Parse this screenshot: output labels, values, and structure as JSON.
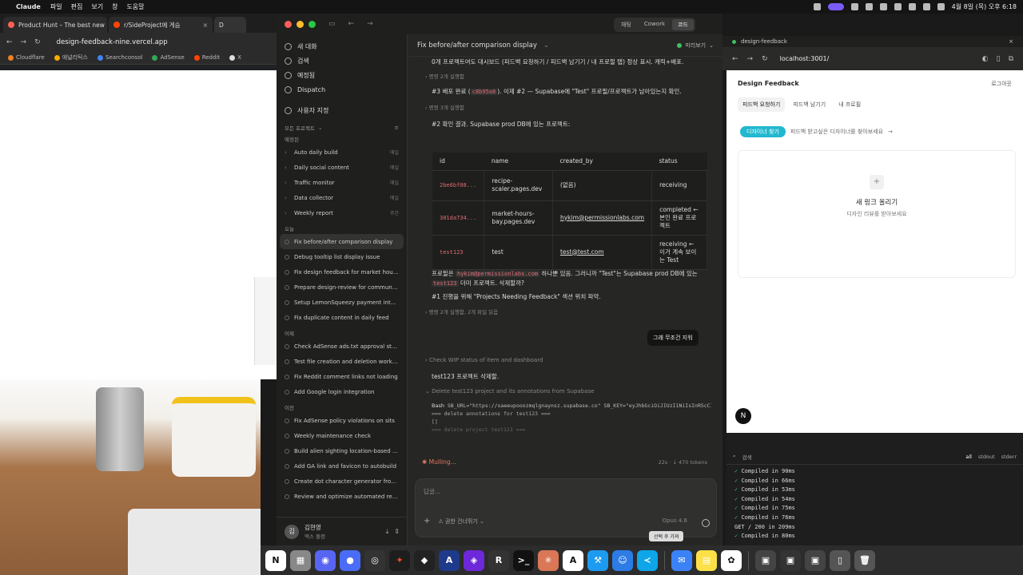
{
  "menubar": {
    "app": "Claude",
    "items": [
      "파일",
      "편집",
      "보기",
      "창",
      "도움말"
    ],
    "clock": "4월 8일 (목) 오후 6:18"
  },
  "browser": {
    "tabs": [
      {
        "title": "Product Hunt – The best new",
        "color": "#ff6154"
      },
      {
        "title": "r/SideProject에 게슴",
        "color": "#ff4500"
      },
      {
        "title": "D",
        "color": "#333"
      }
    ],
    "url": "design-feedback-nine.vercel.app",
    "bookmarks": [
      "Cloudflare",
      "애널리틱스",
      "Searchconsol",
      "AdSense",
      "Reddit",
      "X"
    ]
  },
  "claude": {
    "mode_tabs": [
      "채팅",
      "Cowork",
      "코드"
    ],
    "sidebar": {
      "new_chat": "새 대화",
      "search": "검색",
      "schedule": "예정됨",
      "dispatch": "Dispatch",
      "customize": "사용자 지정",
      "all_projects": "모든 프로젝트",
      "groups": [
        {
          "title": "예정된",
          "items": [
            {
              "label": "Auto daily build",
              "tag": "매일"
            },
            {
              "label": "Daily social content",
              "tag": "매일"
            },
            {
              "label": "Traffic monitor",
              "tag": "매일"
            },
            {
              "label": "Data collector",
              "tag": "매일"
            },
            {
              "label": "Weekly report",
              "tag": "주간"
            }
          ]
        },
        {
          "title": "오늘",
          "items": [
            {
              "label": "Fix before/after comparison display",
              "active": true
            },
            {
              "label": "Debug tooltip list display issue"
            },
            {
              "label": "Fix design feedback for market hours s..."
            },
            {
              "label": "Prepare design-review for community ..."
            },
            {
              "label": "Setup LemonSqueezy payment integra..."
            },
            {
              "label": "Fix duplicate content in daily feed"
            }
          ]
        },
        {
          "title": "어제",
          "items": [
            {
              "label": "Check AdSense ads.txt approval status"
            },
            {
              "label": "Test file creation and deletion workflow"
            },
            {
              "label": "Fix Reddit comment links not loading"
            },
            {
              "label": "Add Google login integration"
            }
          ]
        },
        {
          "title": "이전",
          "items": [
            {
              "label": "Fix AdSense policy violations on sits"
            },
            {
              "label": "Weekly maintenance check"
            },
            {
              "label": "Build alien sighting location-based vide..."
            },
            {
              "label": "Add GA link and favicon to autobuild"
            },
            {
              "label": "Create dot character generator from p..."
            },
            {
              "label": "Review and optimize automated reven..."
            }
          ]
        }
      ],
      "user": {
        "initial": "김",
        "name": "김현영",
        "plan": "맥스 플랜"
      }
    },
    "chat": {
      "title": "Fix before/after comparison display",
      "preview": "미리보기",
      "line1": "0개 프로젝트여도 대시보드 (피드백 요청하기 / 피드백 남기기 / 내 프로필 탭) 정상 표시. 캐릭+배포.",
      "cmd1": "명령 2개 실행함",
      "step3_a": "#3 배포 완료 (",
      "step3_code": "c8b95a8",
      "step3_b": "). 이제 #2 — Supabase에 \"Test\" 프로필/프로젝트가 남아있는지 확인.",
      "cmd2": "명령 3개 실행함",
      "result_title": "#2 확인 결과. Supabase prod DB에 있는 프로젝트:",
      "table": {
        "headers": [
          "id",
          "name",
          "created_by",
          "status"
        ],
        "rows": [
          [
            "2be6bf08...",
            "recipe-scaler.pages.dev",
            "(없음)",
            "receiving"
          ],
          [
            "301da734...",
            "market-hours-bay.pages.dev",
            "hykim@permissionlabs.com",
            "completed ← 본인 완료 프로젝트"
          ],
          [
            "test123",
            "test",
            "test@test.com",
            "receiving ← 이거 계속 보이는 Test"
          ]
        ]
      },
      "note_a": "프로필은",
      "note_email": "hykim@permissionlabs.com",
      "note_b": "하나뿐 있음. 그러니까 \"Test\"는 Supabase prod DB에 있는",
      "note_code": "test123",
      "note_c": "더미 프로젝트. 삭제할까?",
      "step1": "#1 진행을 위해 \"Projects Needing Feedback\" 섹션 위치 파악.",
      "cmd3": "명령 2개 실행함, 2개 파일 읽음",
      "user_msg": "그래 무조건 지워",
      "check_wip": "Check WIP status of item and dashboard",
      "deleting": "test123 프로젝트 삭제할.",
      "delete_task": "Delete test123 project and its annotations from Supabase",
      "bash_label": "Bash",
      "bash_cmd": "SB_URL=\"https://saeeupooozmqlgnaynsz.supabase.co\" SB_KEY=\"eyJhbGciOiJIUzI1NiIsInR5cCI...",
      "bash_out": [
        "=== delete annotations for test123 ===",
        "[]",
        "=== delete project test123 ==="
      ],
      "status": "✱ Mulling...",
      "tokens": "22s · ↓ 470 tokens",
      "input_placeholder": "답글...",
      "perm_label": "권한 건너뛰기",
      "model": "Opus 4.6",
      "tooltip": "선택 후 가져"
    }
  },
  "devbrowser": {
    "tab": "design-feedback",
    "url": "localhost:3001/",
    "app": {
      "title": "Design Feedback",
      "login": "로그아웃",
      "tabs": [
        "피드백 요청하기",
        "피드백 남기기",
        "내 프로필"
      ],
      "pill": "디자이너 찾기",
      "pill_hint": "피드백 받고싶은 디자이너를 찾아보세요",
      "arrow": "→",
      "upload_title": "새 링크 올리기",
      "upload_sub": "디자인 리뷰를 받아보세요",
      "badge": "N"
    },
    "terminal": {
      "search": "검색",
      "filters": [
        "all",
        "stdout",
        "stderr"
      ],
      "lines": [
        "Compiled in 90ms",
        "Compiled in 66ms",
        "Compiled in 53ms",
        "Compiled in 54ms",
        "Compiled in 75ms",
        "Compiled in 76ms",
        "GET / 200 in 209ms",
        "Compiled in 80ms"
      ]
    }
  },
  "colors": {
    "accent": "#e07a5f",
    "code_red": "#e06c75",
    "teal": "#22b8cf"
  }
}
